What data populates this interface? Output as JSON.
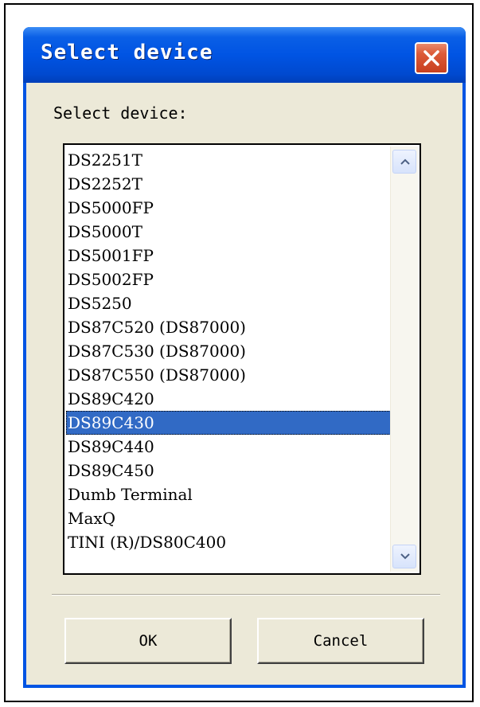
{
  "dialog": {
    "title": "Select device",
    "close_icon": "close-x-icon"
  },
  "prompt": "Select device:",
  "devices": [
    "DS2251T",
    "DS2252T",
    "DS5000FP",
    "DS5000T",
    "DS5001FP",
    "DS5002FP",
    "DS5250",
    "DS87C520 (DS87000)",
    "DS87C530 (DS87000)",
    "DS87C550 (DS87000)",
    "DS89C420",
    "DS89C430",
    "DS89C440",
    "DS89C450",
    "Dumb Terminal",
    "MaxQ",
    "TINI (R)/DS80C400"
  ],
  "selected_device": "DS89C430",
  "buttons": {
    "ok": "OK",
    "cancel": "Cancel"
  },
  "colors": {
    "titlebar": "#0054e3",
    "selection": "#316ac5",
    "dialog_face": "#ece9d8",
    "close_button": "#dc5a38"
  }
}
